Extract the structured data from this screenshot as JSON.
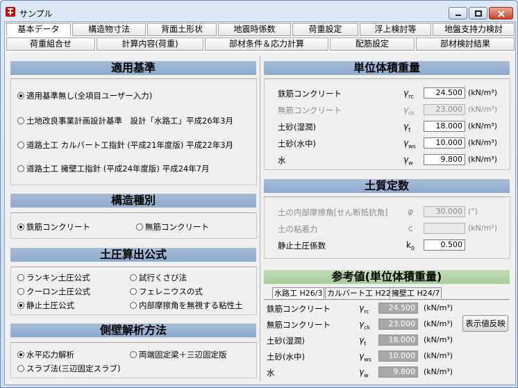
{
  "window": {
    "title": "サンプル"
  },
  "tabs_row1": [
    "基本データ",
    "構造物寸法",
    "背面土形状",
    "地震時係数",
    "荷重設定",
    "浮上検討等",
    "地盤支持力検討"
  ],
  "tabs_row2": [
    "荷重組合せ",
    "計算内容(荷重)",
    "部材条件＆応力計算",
    "配筋設定",
    "部材検討結果"
  ],
  "applicable": {
    "title": "適用基準",
    "options": [
      "適用基準無し(全項目ユーザー入力)",
      "土地改良事業計画設計基準　設計「水路工」平成26年3月",
      "道路土工 カルバート工指針 (平成21年度版) 平成22年3月",
      "道路土工 擁壁工指針 (平成24年度版) 平成24年7月"
    ],
    "selected": 0
  },
  "structure": {
    "title": "構造種別",
    "options": [
      "鉄筋コンクリート",
      "無筋コンクリート"
    ],
    "selected": 0
  },
  "earth_pressure": {
    "title": "土圧算出公式",
    "options": [
      "ランキン土圧公式",
      "試行くさび法",
      "クーロン土圧公式",
      "フェレニウスの式",
      "静止土圧公式",
      "内部摩擦角を無視する粘性土"
    ],
    "selected": 4
  },
  "side_wall": {
    "title": "側壁解析方法",
    "options": [
      "水平応力解析",
      "両端固定梁＋三辺固定版",
      "スラブ法(三辺固定スラブ)"
    ],
    "selected": 0
  },
  "unit_weight": {
    "title": "単位体積重量",
    "rows": [
      {
        "label": "鉄筋コンクリート",
        "sym": "γ",
        "sub": "rc",
        "value": "24.500",
        "unit": "(kN/m³)"
      },
      {
        "label": "無筋コンクリート",
        "sym": "γ",
        "sub": "ck",
        "value": "23.000",
        "unit": "(kN/m³)"
      },
      {
        "label": "土砂(湿潤)",
        "sym": "γ",
        "sub": "t",
        "value": "18.000",
        "unit": "(kN/m³)"
      },
      {
        "label": "土砂(水中)",
        "sym": "γ",
        "sub": "ws",
        "value": "10.000",
        "unit": "(kN/m³)"
      },
      {
        "label": "水",
        "sym": "γ",
        "sub": "w",
        "value": "9.800",
        "unit": "(kN/m³)"
      }
    ]
  },
  "soil": {
    "title": "土質定数",
    "rows": [
      {
        "label": "土の内部摩擦角[せん断抵抗角]",
        "sym": "φ",
        "value": "30.000",
        "unit": "(°)"
      },
      {
        "label": "土の粘着力",
        "sym": "c",
        "value": "",
        "unit": "(kN/m²)"
      },
      {
        "label": "静止土圧係数",
        "sym": "k",
        "sub": "0",
        "value": "0.500",
        "unit": ""
      }
    ]
  },
  "reference": {
    "title": "参考値(単位体積重量)",
    "tabs": [
      "水路工 H26/3",
      "カルバート工 H22",
      "擁壁工 H24/7"
    ],
    "rows": [
      {
        "label": "鉄筋コンクリート",
        "sym": "γ",
        "sub": "rc",
        "value": "24.500",
        "unit": "(kN/m³)"
      },
      {
        "label": "無筋コンクリート",
        "sym": "γ",
        "sub": "ck",
        "value": "23.000",
        "unit": "(kN/m³)"
      },
      {
        "label": "土砂(湿潤)",
        "sym": "γ",
        "sub": "t",
        "value": "18.000",
        "unit": "(kN/m³)"
      },
      {
        "label": "土砂(水中)",
        "sym": "γ",
        "sub": "ws",
        "value": "10.000",
        "unit": "(kN/m³)"
      },
      {
        "label": "水",
        "sym": "γ",
        "sub": "w",
        "value": "9.800",
        "unit": "(kN/m³)"
      }
    ],
    "apply_button": "表示値反映"
  }
}
